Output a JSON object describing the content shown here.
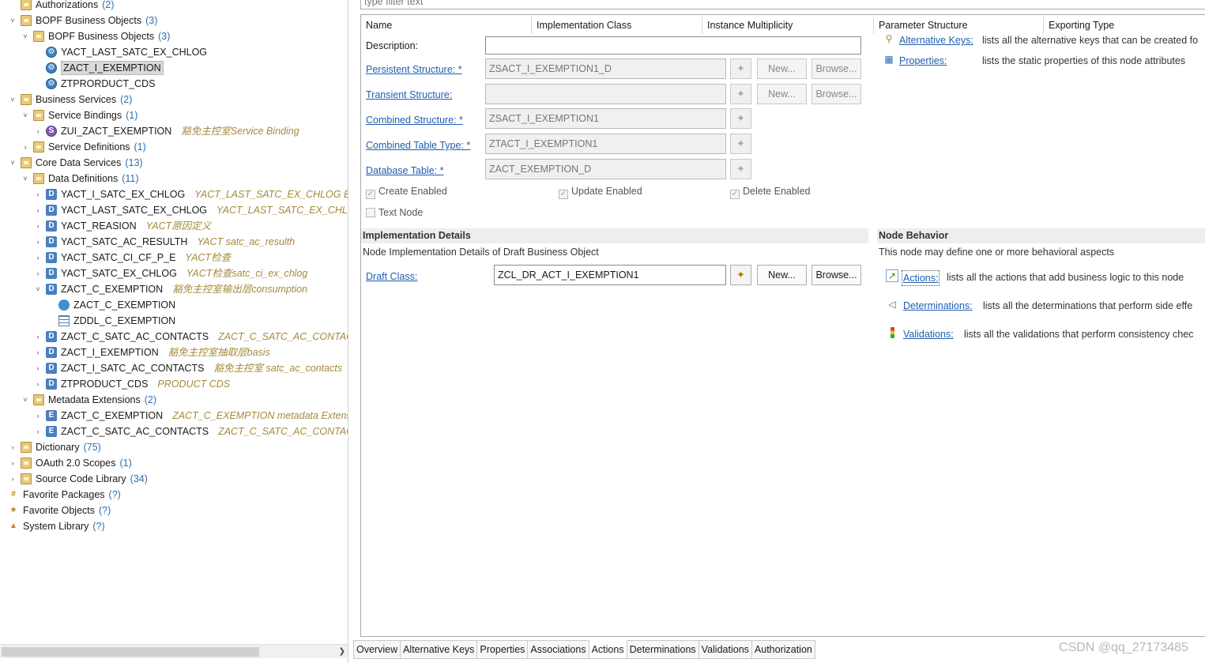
{
  "tree": {
    "items": [
      {
        "label": "Authorizations",
        "count": "(2)",
        "desc": ""
      },
      {
        "label": "BOPF Business Objects",
        "count": "(3)",
        "desc": ""
      },
      {
        "label": "BOPF Business Objects",
        "count": "(3)",
        "desc": ""
      },
      {
        "label": "YACT_LAST_SATC_EX_CHLOG",
        "count": "",
        "desc": ""
      },
      {
        "label": "ZACT_I_EXEMPTION",
        "count": "",
        "desc": ""
      },
      {
        "label": "ZTPRORDUCT_CDS",
        "count": "",
        "desc": ""
      },
      {
        "label": "Business Services",
        "count": "(2)",
        "desc": ""
      },
      {
        "label": "Service Bindings",
        "count": "(1)",
        "desc": ""
      },
      {
        "label": "ZUI_ZACT_EXEMPTION",
        "count": "",
        "desc": "豁免主控室Service Binding"
      },
      {
        "label": "Service Definitions",
        "count": "(1)",
        "desc": ""
      },
      {
        "label": "Core Data Services",
        "count": "(13)",
        "desc": ""
      },
      {
        "label": "Data Definitions",
        "count": "(11)",
        "desc": ""
      },
      {
        "label": "YACT_I_SATC_EX_CHLOG",
        "count": "",
        "desc": "YACT_LAST_SATC_EX_CHLOG Basis"
      },
      {
        "label": "YACT_LAST_SATC_EX_CHLOG",
        "count": "",
        "desc": "YACT_LAST_SATC_EX_CHLOG"
      },
      {
        "label": "YACT_REASION",
        "count": "",
        "desc": "YACT原因定义"
      },
      {
        "label": "YACT_SATC_AC_RESULTH",
        "count": "",
        "desc": "YACT satc_ac_resulth"
      },
      {
        "label": "YACT_SATC_CI_CF_P_E",
        "count": "",
        "desc": "YACT检查"
      },
      {
        "label": "YACT_SATC_EX_CHLOG",
        "count": "",
        "desc": "YACT检查satc_ci_ex_chlog"
      },
      {
        "label": "ZACT_C_EXEMPTION",
        "count": "",
        "desc": "豁免主控室输出层consumption"
      },
      {
        "label": "ZACT_C_EXEMPTION",
        "count": "",
        "desc": ""
      },
      {
        "label": "ZDDL_C_EXEMPTION",
        "count": "",
        "desc": ""
      },
      {
        "label": "ZACT_C_SATC_AC_CONTACTS",
        "count": "",
        "desc": "ZACT_C_SATC_AC_CONTACTS 豁"
      },
      {
        "label": "ZACT_I_EXEMPTION",
        "count": "",
        "desc": "豁免主控室抽取层basis"
      },
      {
        "label": "ZACT_I_SATC_AC_CONTACTS",
        "count": "",
        "desc": "豁免主控室 satc_ac_contacts"
      },
      {
        "label": "ZTPRODUCT_CDS",
        "count": "",
        "desc": "PRODUCT CDS"
      },
      {
        "label": "Metadata Extensions",
        "count": "(2)",
        "desc": ""
      },
      {
        "label": "ZACT_C_EXEMPTION",
        "count": "",
        "desc": "ZACT_C_EXEMPTION metadata Extensio"
      },
      {
        "label": "ZACT_C_SATC_AC_CONTACTS",
        "count": "",
        "desc": "ZACT_C_SATC_AC_CONTACTS m"
      },
      {
        "label": "Dictionary",
        "count": "(75)",
        "desc": ""
      },
      {
        "label": "OAuth 2.0 Scopes",
        "count": "(1)",
        "desc": ""
      },
      {
        "label": "Source Code Library",
        "count": "(34)",
        "desc": ""
      },
      {
        "label": "Favorite Packages",
        "count": "(?)",
        "desc": ""
      },
      {
        "label": "Favorite Objects",
        "count": "(?)",
        "desc": ""
      },
      {
        "label": "System Library",
        "count": "(?)",
        "desc": ""
      }
    ]
  },
  "filter": {
    "placeholder": "type filter text"
  },
  "columns": {
    "name": "Name",
    "impl_class": "Implementation Class",
    "instance_multiplicity": "Instance Multiplicity",
    "parameter_structure": "Parameter Structure",
    "exporting_type": "Exporting Type"
  },
  "form": {
    "description_label": "Description:",
    "description_value": "",
    "persistent_label": "Persistent Structure: *",
    "persistent_value": "ZSACT_I_EXEMPTION1_D",
    "transient_label": "Transient Structure:",
    "transient_value": "",
    "combined_label": "Combined Structure: *",
    "combined_value": "ZSACT_I_EXEMPTION1",
    "combined_table_label": "Combined Table Type: *",
    "combined_table_value": "ZTACT_I_EXEMPTION1",
    "database_table_label": "Database Table: *",
    "database_table_value": "ZACT_EXEMPTION_D",
    "new_label": "New...",
    "browse_label": "Browse..."
  },
  "checkboxes": {
    "create_enabled": "Create Enabled",
    "update_enabled": "Update Enabled",
    "delete_enabled": "Delete Enabled",
    "text_node": "Text Node"
  },
  "side_links": {
    "alternative_keys_label": "Alternative Keys:",
    "alternative_keys_desc": "lists all the alternative keys that can be created fo",
    "properties_label": "Properties:",
    "properties_desc": "lists the static properties of this node attributes"
  },
  "impl": {
    "title": "Implementation Details",
    "subtitle": "Node Implementation Details of Draft Business Object",
    "draft_class_label": "Draft Class:",
    "draft_class_value": "ZCL_DR_ACT_I_EXEMPTION1",
    "new_label": "New...",
    "browse_label": "Browse..."
  },
  "node_behavior": {
    "title": "Node Behavior",
    "subtitle": "This node may define one or more behavioral aspects",
    "actions_label": "Actions:",
    "actions_desc": "lists all the actions that add business logic to this node",
    "determinations_label": "Determinations:",
    "determinations_desc": "lists all the determinations that perform side effe",
    "validations_label": "Validations:",
    "validations_desc": "lists all the validations that perform consistency chec"
  },
  "tabs": [
    "Overview",
    "Alternative Keys",
    "Properties",
    "Associations",
    "Actions",
    "Determinations",
    "Validations",
    "Authorization"
  ],
  "active_tab": "Actions",
  "watermark": "CSDN @qq_27173485",
  "colors": {
    "link": "#1f5fb0",
    "count": "#2a6fb0",
    "desc": "#a58a3c"
  }
}
